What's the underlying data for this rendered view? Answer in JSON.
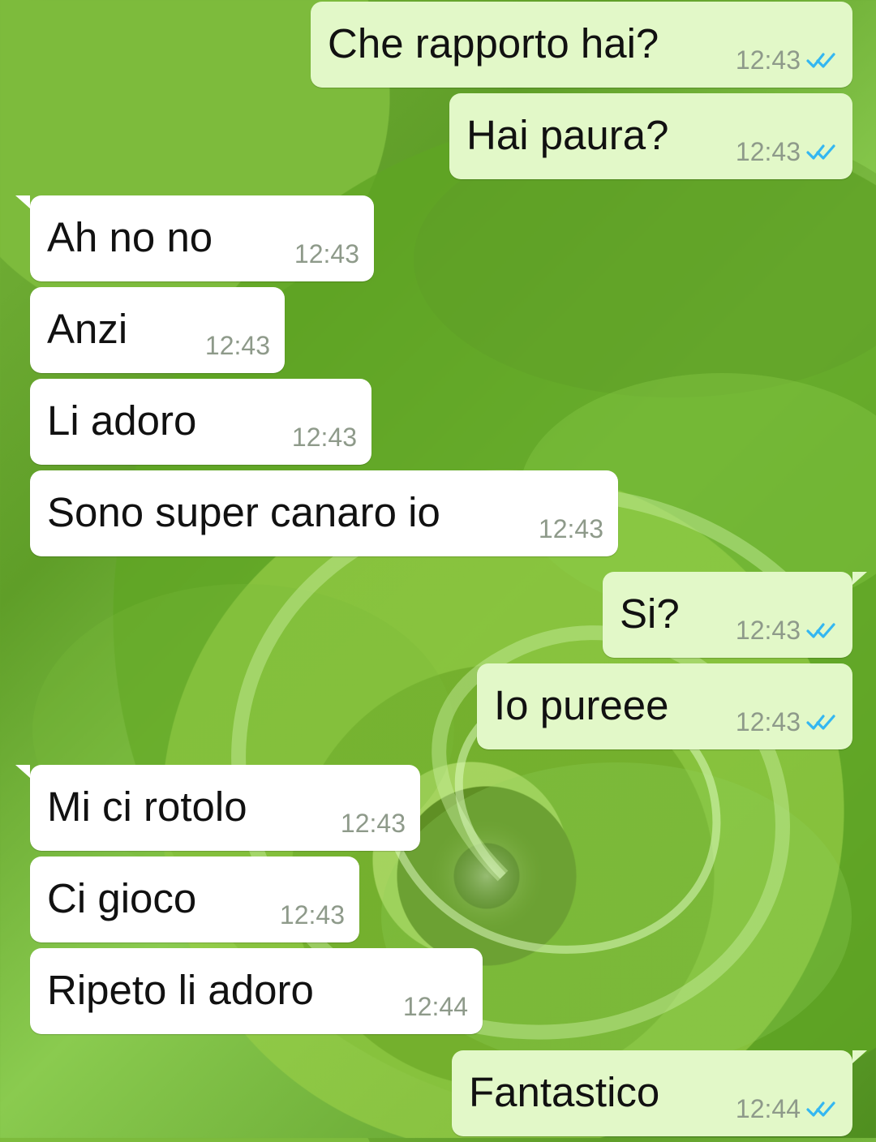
{
  "conversation": {
    "messages": [
      {
        "direction": "outgoing",
        "text": "Che rapporto hai?",
        "time": "12:43",
        "status_icon": "double-check-icon"
      },
      {
        "direction": "outgoing",
        "text": "Hai paura?",
        "time": "12:43",
        "status_icon": "double-check-icon"
      },
      {
        "direction": "incoming",
        "text": "Ah no no",
        "time": "12:43"
      },
      {
        "direction": "incoming",
        "text": "Anzi",
        "time": "12:43"
      },
      {
        "direction": "incoming",
        "text": "Li adoro",
        "time": "12:43"
      },
      {
        "direction": "incoming",
        "text": "Sono super canaro io",
        "time": "12:43"
      },
      {
        "direction": "outgoing",
        "text": "Si?",
        "time": "12:43",
        "status_icon": "double-check-icon"
      },
      {
        "direction": "outgoing",
        "text": "Io pureee",
        "time": "12:43",
        "status_icon": "double-check-icon"
      },
      {
        "direction": "incoming",
        "text": "Mi ci rotolo",
        "time": "12:43"
      },
      {
        "direction": "incoming",
        "text": "Ci gioco",
        "time": "12:43"
      },
      {
        "direction": "incoming",
        "text": "Ripeto li adoro",
        "time": "12:44"
      },
      {
        "direction": "outgoing",
        "text": "Fantastico",
        "time": "12:44",
        "status_icon": "double-check-icon"
      }
    ]
  },
  "colors": {
    "outgoing_bubble": "#e2f8c8",
    "incoming_bubble": "#ffffff",
    "read_receipt": "#34b7f1",
    "timestamp": "#8e9a8a",
    "wallpaper": "#6fb03a"
  }
}
